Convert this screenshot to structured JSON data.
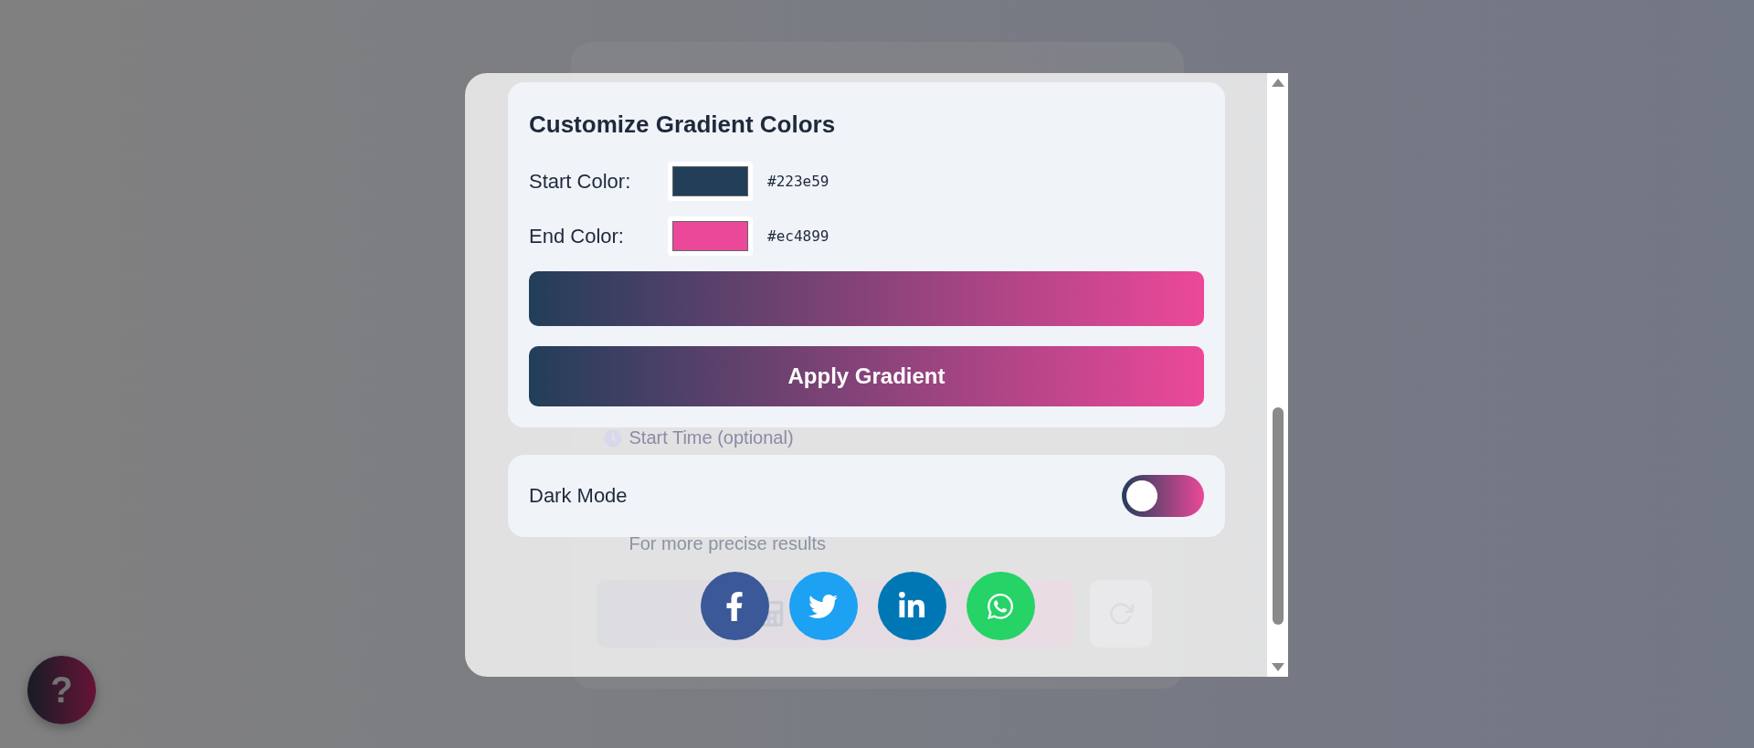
{
  "background_form": {
    "start_time_label": "Start Time (optional)",
    "hint": "For more precise results"
  },
  "help_button": {
    "label": "?"
  },
  "gradient_panel": {
    "title": "Customize Gradient Colors",
    "colors": [
      {
        "label": "Start Color:",
        "value": "#223e59",
        "color": "#223e59"
      },
      {
        "label": "End Color:",
        "value": "#ec4899",
        "color": "#ec4899"
      }
    ],
    "apply_button": "Apply Gradient"
  },
  "dark_mode": {
    "label": "Dark Mode",
    "on": false
  },
  "share": [
    {
      "kind": "facebook"
    },
    {
      "kind": "twitter"
    },
    {
      "kind": "linkedin"
    },
    {
      "kind": "whatsapp"
    }
  ]
}
